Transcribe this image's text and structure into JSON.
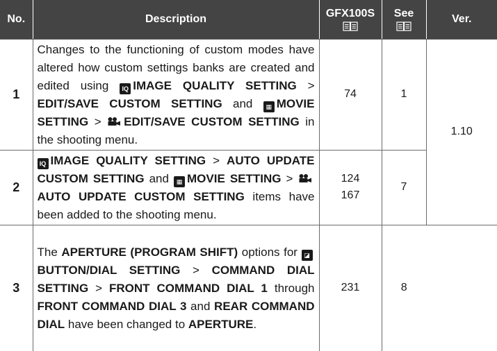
{
  "headers": {
    "no": "No.",
    "description": "Description",
    "model": "GFX100S",
    "see": "See",
    "ver": "Ver."
  },
  "rows": [
    {
      "no": "1",
      "text": {
        "a": "Changes to the functioning of custom modes have altered how custom settings banks are created and edited using ",
        "b1": "IMAGE QUALITY SETTING",
        "c1": " > ",
        "b2": "EDIT/SAVE CUSTOM SETTING",
        "c2": " and ",
        "b3": "MOVIE SETTING",
        "c3": " > ",
        "b4": "EDIT/SAVE CUSTOM SETTING",
        "c4": " in the shooting menu."
      },
      "pages": [
        "74"
      ],
      "see": "1"
    },
    {
      "no": "2",
      "text": {
        "b1": "IMAGE QUALITY SETTING",
        "c1": " > ",
        "b2": "AUTO UPDATE CUSTOM SETTING",
        "c2": " and ",
        "b3": "MOVIE SETTING",
        "c3": " > ",
        "b4": "AUTO UPDATE CUSTOM SETTING",
        "c4": " items have been added to the shooting menu."
      },
      "pages": [
        "124",
        "167"
      ],
      "see": "7"
    },
    {
      "no": "3",
      "text": {
        "a": "The ",
        "b1": "APERTURE (PROGRAM SHIFT)",
        "c1": " options for ",
        "b2": "BUTTON/DIAL SETTING",
        "c2": " > ",
        "b3": "COMMAND DIAL SETTING",
        "c3": " > ",
        "b4": "FRONT COMMAND DIAL 1",
        "c4": " through ",
        "b5": "FRONT COMMAND DIAL 3",
        "c5": " and ",
        "b6": "REAR COMMAND DIAL",
        "c6": " have been changed to ",
        "b7": "APERTURE",
        "c7": "."
      },
      "pages": [
        "231"
      ],
      "see": "8"
    }
  ],
  "version": "1.10",
  "icons": {
    "book": "book-icon",
    "image_quality": "image-quality-icon",
    "movie_setting": "movie-setting-icon",
    "movie_camera": "movie-camera-icon",
    "button_dial": "button-dial-icon"
  },
  "colors": {
    "header_bg": "#444444",
    "header_text": "#ffffff",
    "border": "#6a6a6a"
  }
}
